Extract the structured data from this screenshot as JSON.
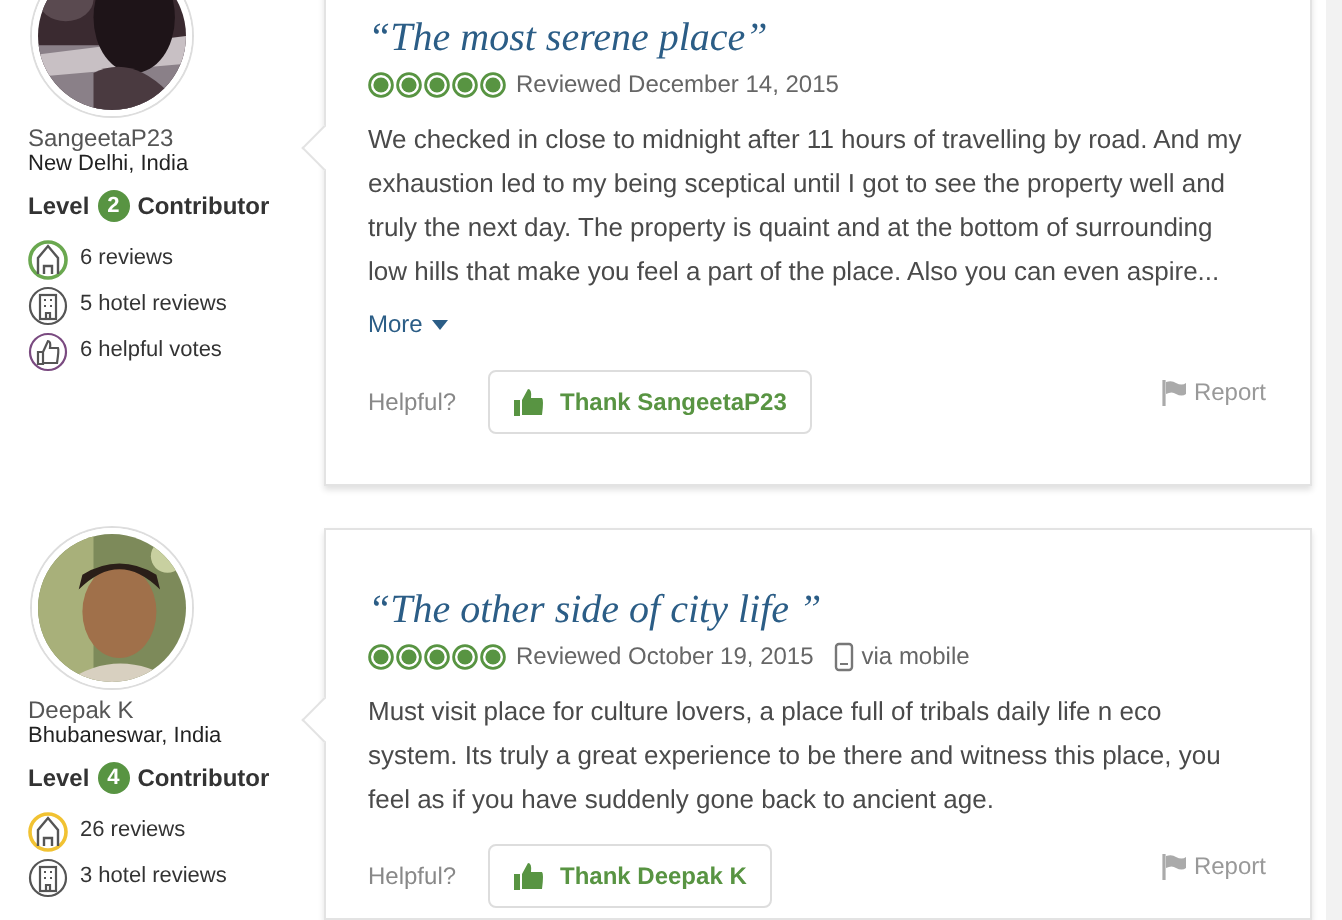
{
  "reviews": [
    {
      "reviewer": {
        "name": "SangeetaP23",
        "location": "New Delhi, India",
        "level_prefix": "Level",
        "level": "2",
        "level_suffix": "Contributor",
        "stats": [
          {
            "kind": "reviews",
            "text": "6 reviews",
            "color": "#6aa84f"
          },
          {
            "kind": "hotel",
            "text": "5 hotel reviews"
          },
          {
            "kind": "helpful",
            "text": "6 helpful votes"
          }
        ]
      },
      "title": "“The most serene place”",
      "stars": 5,
      "date": "Reviewed December 14, 2015",
      "body": "We checked in close to midnight after 11 hours of travelling by road. And my exhaustion led to my being sceptical until I got to see the property well and truly the next day. The property is quaint and at the bottom of surrounding low hills that make you feel a part of the place. Also you can even aspire...",
      "more": "More",
      "helpful_label": "Helpful?",
      "thank": "Thank SangeetaP23",
      "report": "Report"
    },
    {
      "reviewer": {
        "name": "Deepak K",
        "location": "Bhubaneswar, India",
        "level_prefix": "Level",
        "level": "4",
        "level_suffix": "Contributor",
        "stats": [
          {
            "kind": "reviews",
            "text": "26 reviews",
            "color": "#f1c232"
          },
          {
            "kind": "hotel",
            "text": "3 hotel reviews"
          }
        ]
      },
      "title": "“The other side of city life ”",
      "stars": 5,
      "date": "Reviewed October 19, 2015",
      "via": "via mobile",
      "body": "Must visit place for culture lovers, a place full of tribals daily life n eco system. Its truly a great experience to be there and witness this place, you feel as if you have suddenly gone back to ancient age.",
      "helpful_label": "Helpful?",
      "thank": "Thank Deepak K",
      "report": "Report"
    }
  ]
}
